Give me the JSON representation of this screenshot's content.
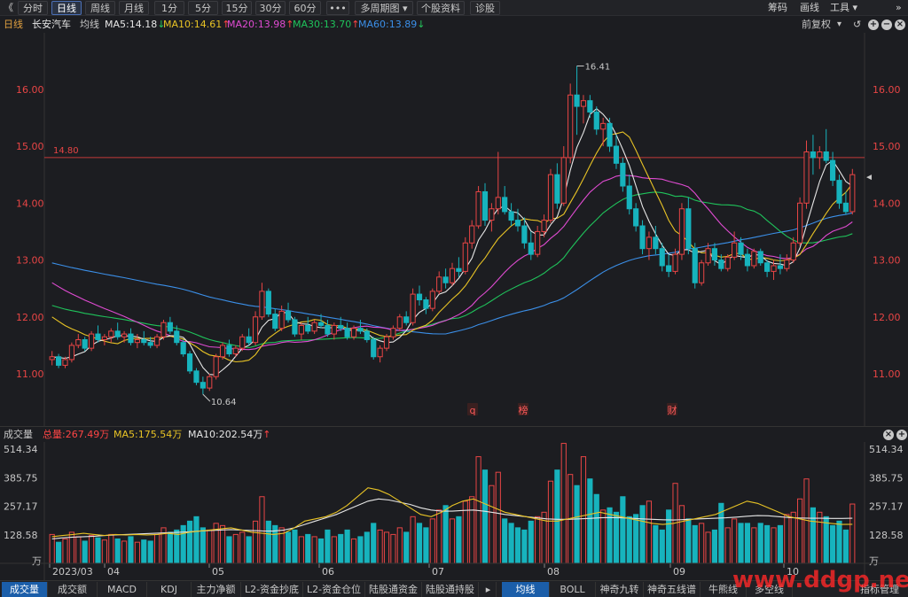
{
  "toolbar": {
    "back": "《",
    "periods": [
      "分时",
      "日线",
      "周线",
      "月线",
      "1分",
      "5分",
      "15分",
      "30分",
      "60分"
    ],
    "active_period": "日线",
    "more": "•••",
    "multi_period": "多周期图",
    "stock_info": "个股资料",
    "diagnose": "诊股",
    "right_tools": [
      "筹码",
      "画线",
      "工具"
    ]
  },
  "stock_header": {
    "period_label": "日线",
    "name": "长安汽车",
    "ma_type": "均线",
    "ma": [
      {
        "label": "MA5:14.18",
        "arrow": "↓",
        "color": "#e6e6e6",
        "arrow_color": "#24c35b"
      },
      {
        "label": "MA10:14.61",
        "arrow": "↑",
        "color": "#e8c325",
        "arrow_color": "#ff4545"
      },
      {
        "label": "MA20:13.98",
        "arrow": "↑",
        "color": "#e04bd2",
        "arrow_color": "#ff4545"
      },
      {
        "label": "MA30:13.70",
        "arrow": "↑",
        "color": "#1fc35b",
        "arrow_color": "#ff4545"
      },
      {
        "label": "MA60:13.89",
        "arrow": "↓",
        "color": "#3b8fe8",
        "arrow_color": "#24c35b"
      }
    ],
    "adjust": "前复权"
  },
  "price_axis": {
    "ticks": [
      "16.00",
      "15.00",
      "14.00",
      "13.00",
      "12.00",
      "11.00"
    ],
    "values": [
      16,
      15,
      14,
      13,
      12,
      11
    ],
    "range": [
      10.3,
      16.9
    ],
    "color": "#e84545"
  },
  "annotations": {
    "line_label": "14.80",
    "line_value": 14.8,
    "high_label": "16.41",
    "high_value": 16.41,
    "low_label": "10.64",
    "low_value": 10.64,
    "events": [
      "q",
      "榜",
      "财"
    ]
  },
  "volume_header": {
    "title": "成交量",
    "total": "总量:267.49万",
    "ma5": "MA5:175.54万",
    "ma10": "MA10:202.54万",
    "ma10_arrow": "↑"
  },
  "volume_axis": {
    "ticks": [
      "514.34",
      "385.75",
      "257.17",
      "128.58"
    ],
    "values": [
      514.34,
      385.75,
      257.17,
      128.58
    ],
    "unit": "万",
    "range": [
      0,
      514.34
    ]
  },
  "date_axis": [
    "2023/03",
    "04",
    "05",
    "06",
    "07",
    "08",
    "09",
    "10"
  ],
  "bottom_tabs_left": [
    "成交量",
    "成交额",
    "MACD",
    "KDJ",
    "主力净额",
    "L2-资金抄底",
    "L2-资金仓位",
    "陆股通资金",
    "陆股通持股"
  ],
  "bottom_tabs_right": [
    "均线",
    "BOLL",
    "神奇九转",
    "神奇五线谱",
    "牛熊线",
    "多空线"
  ],
  "bottom_manage": "指标管理",
  "watermark": "www.ddgp.net",
  "chart_data": {
    "type": "candlestick",
    "title": "长安汽车 日线",
    "candles": [
      {
        "o": 11.25,
        "h": 11.4,
        "l": 11.15,
        "c": 11.3
      },
      {
        "o": 11.3,
        "h": 11.35,
        "l": 11.1,
        "c": 11.15
      },
      {
        "o": 11.15,
        "h": 11.3,
        "l": 11.1,
        "c": 11.25
      },
      {
        "o": 11.25,
        "h": 11.55,
        "l": 11.2,
        "c": 11.5
      },
      {
        "o": 11.5,
        "h": 11.7,
        "l": 11.45,
        "c": 11.6
      },
      {
        "o": 11.6,
        "h": 11.65,
        "l": 11.4,
        "c": 11.45
      },
      {
        "o": 11.45,
        "h": 11.75,
        "l": 11.4,
        "c": 11.7
      },
      {
        "o": 11.7,
        "h": 11.85,
        "l": 11.55,
        "c": 11.6
      },
      {
        "o": 11.6,
        "h": 11.7,
        "l": 11.5,
        "c": 11.65
      },
      {
        "o": 11.65,
        "h": 11.8,
        "l": 11.55,
        "c": 11.75
      },
      {
        "o": 11.75,
        "h": 11.9,
        "l": 11.6,
        "c": 11.65
      },
      {
        "o": 11.65,
        "h": 11.75,
        "l": 11.55,
        "c": 11.7
      },
      {
        "o": 11.7,
        "h": 11.8,
        "l": 11.5,
        "c": 11.55
      },
      {
        "o": 11.55,
        "h": 11.7,
        "l": 11.45,
        "c": 11.6
      },
      {
        "o": 11.6,
        "h": 11.75,
        "l": 11.5,
        "c": 11.55
      },
      {
        "o": 11.55,
        "h": 11.65,
        "l": 11.45,
        "c": 11.5
      },
      {
        "o": 11.5,
        "h": 11.7,
        "l": 11.45,
        "c": 11.65
      },
      {
        "o": 11.65,
        "h": 11.95,
        "l": 11.6,
        "c": 11.9
      },
      {
        "o": 11.9,
        "h": 12.0,
        "l": 11.7,
        "c": 11.75
      },
      {
        "o": 11.75,
        "h": 11.85,
        "l": 11.5,
        "c": 11.55
      },
      {
        "o": 11.55,
        "h": 11.6,
        "l": 11.3,
        "c": 11.35
      },
      {
        "o": 11.35,
        "h": 11.4,
        "l": 11.0,
        "c": 11.05
      },
      {
        "o": 11.05,
        "h": 11.1,
        "l": 10.8,
        "c": 10.85
      },
      {
        "o": 10.85,
        "h": 10.95,
        "l": 10.64,
        "c": 10.75
      },
      {
        "o": 10.75,
        "h": 11.0,
        "l": 10.7,
        "c": 10.95
      },
      {
        "o": 10.95,
        "h": 11.35,
        "l": 10.9,
        "c": 11.3
      },
      {
        "o": 11.3,
        "h": 11.55,
        "l": 11.25,
        "c": 11.5
      },
      {
        "o": 11.5,
        "h": 11.6,
        "l": 11.3,
        "c": 11.35
      },
      {
        "o": 11.35,
        "h": 11.5,
        "l": 11.3,
        "c": 11.45
      },
      {
        "o": 11.45,
        "h": 11.7,
        "l": 11.4,
        "c": 11.65
      },
      {
        "o": 11.65,
        "h": 11.8,
        "l": 11.5,
        "c": 11.55
      },
      {
        "o": 11.55,
        "h": 12.1,
        "l": 11.5,
        "c": 12.0
      },
      {
        "o": 12.0,
        "h": 12.6,
        "l": 11.95,
        "c": 12.45
      },
      {
        "o": 12.45,
        "h": 12.5,
        "l": 12.0,
        "c": 12.05
      },
      {
        "o": 12.05,
        "h": 12.15,
        "l": 11.75,
        "c": 11.8
      },
      {
        "o": 11.8,
        "h": 12.2,
        "l": 11.75,
        "c": 12.1
      },
      {
        "o": 12.1,
        "h": 12.25,
        "l": 11.9,
        "c": 11.95
      },
      {
        "o": 11.95,
        "h": 12.0,
        "l": 11.65,
        "c": 11.7
      },
      {
        "o": 11.7,
        "h": 11.9,
        "l": 11.6,
        "c": 11.85
      },
      {
        "o": 11.85,
        "h": 12.0,
        "l": 11.7,
        "c": 11.75
      },
      {
        "o": 11.75,
        "h": 11.95,
        "l": 11.7,
        "c": 11.9
      },
      {
        "o": 11.9,
        "h": 12.05,
        "l": 11.8,
        "c": 11.85
      },
      {
        "o": 11.85,
        "h": 11.95,
        "l": 11.65,
        "c": 11.7
      },
      {
        "o": 11.7,
        "h": 11.9,
        "l": 11.6,
        "c": 11.85
      },
      {
        "o": 11.85,
        "h": 12.0,
        "l": 11.75,
        "c": 11.8
      },
      {
        "o": 11.8,
        "h": 11.9,
        "l": 11.6,
        "c": 11.65
      },
      {
        "o": 11.65,
        "h": 11.85,
        "l": 11.6,
        "c": 11.8
      },
      {
        "o": 11.8,
        "h": 11.95,
        "l": 11.7,
        "c": 11.75
      },
      {
        "o": 11.75,
        "h": 11.8,
        "l": 11.55,
        "c": 11.6
      },
      {
        "o": 11.6,
        "h": 11.65,
        "l": 11.25,
        "c": 11.3
      },
      {
        "o": 11.3,
        "h": 11.5,
        "l": 11.2,
        "c": 11.45
      },
      {
        "o": 11.45,
        "h": 11.7,
        "l": 11.4,
        "c": 11.65
      },
      {
        "o": 11.65,
        "h": 11.85,
        "l": 11.6,
        "c": 11.8
      },
      {
        "o": 11.8,
        "h": 12.05,
        "l": 11.75,
        "c": 12.0
      },
      {
        "o": 12.0,
        "h": 12.1,
        "l": 11.85,
        "c": 11.9
      },
      {
        "o": 11.9,
        "h": 12.5,
        "l": 11.85,
        "c": 12.4
      },
      {
        "o": 12.4,
        "h": 12.55,
        "l": 12.2,
        "c": 12.3
      },
      {
        "o": 12.3,
        "h": 12.35,
        "l": 12.05,
        "c": 12.15
      },
      {
        "o": 12.15,
        "h": 12.5,
        "l": 12.1,
        "c": 12.45
      },
      {
        "o": 12.45,
        "h": 12.8,
        "l": 12.4,
        "c": 12.7
      },
      {
        "o": 12.7,
        "h": 12.85,
        "l": 12.5,
        "c": 12.6
      },
      {
        "o": 12.6,
        "h": 12.95,
        "l": 12.55,
        "c": 12.85
      },
      {
        "o": 12.85,
        "h": 13.05,
        "l": 12.7,
        "c": 12.8
      },
      {
        "o": 12.8,
        "h": 13.4,
        "l": 12.75,
        "c": 13.3
      },
      {
        "o": 13.3,
        "h": 13.7,
        "l": 13.2,
        "c": 13.6
      },
      {
        "o": 13.6,
        "h": 14.3,
        "l": 13.55,
        "c": 14.2
      },
      {
        "o": 14.2,
        "h": 14.35,
        "l": 13.6,
        "c": 13.7
      },
      {
        "o": 13.7,
        "h": 14.0,
        "l": 13.5,
        "c": 13.9
      },
      {
        "o": 13.9,
        "h": 14.9,
        "l": 13.8,
        "c": 14.1
      },
      {
        "o": 14.1,
        "h": 14.3,
        "l": 13.8,
        "c": 13.85
      },
      {
        "o": 13.85,
        "h": 14.0,
        "l": 13.6,
        "c": 13.7
      },
      {
        "o": 13.7,
        "h": 13.9,
        "l": 13.5,
        "c": 13.6
      },
      {
        "o": 13.6,
        "h": 13.75,
        "l": 13.2,
        "c": 13.3
      },
      {
        "o": 13.3,
        "h": 13.5,
        "l": 13.0,
        "c": 13.1
      },
      {
        "o": 13.1,
        "h": 13.6,
        "l": 13.05,
        "c": 13.5
      },
      {
        "o": 13.5,
        "h": 13.8,
        "l": 13.4,
        "c": 13.7
      },
      {
        "o": 13.7,
        "h": 14.6,
        "l": 13.65,
        "c": 14.5
      },
      {
        "o": 14.5,
        "h": 14.7,
        "l": 13.9,
        "c": 14.0
      },
      {
        "o": 14.0,
        "h": 15.0,
        "l": 13.95,
        "c": 14.8
      },
      {
        "o": 14.8,
        "h": 16.1,
        "l": 14.7,
        "c": 15.9
      },
      {
        "o": 15.9,
        "h": 16.41,
        "l": 15.2,
        "c": 15.7
      },
      {
        "o": 15.7,
        "h": 15.9,
        "l": 15.4,
        "c": 15.8
      },
      {
        "o": 15.8,
        "h": 15.9,
        "l": 15.5,
        "c": 15.6
      },
      {
        "o": 15.6,
        "h": 15.7,
        "l": 15.2,
        "c": 15.3
      },
      {
        "o": 15.3,
        "h": 15.5,
        "l": 15.0,
        "c": 15.4
      },
      {
        "o": 15.4,
        "h": 15.5,
        "l": 14.9,
        "c": 15.0
      },
      {
        "o": 15.0,
        "h": 15.2,
        "l": 14.6,
        "c": 14.7
      },
      {
        "o": 14.7,
        "h": 14.8,
        "l": 14.2,
        "c": 14.3
      },
      {
        "o": 14.3,
        "h": 14.5,
        "l": 13.8,
        "c": 13.9
      },
      {
        "o": 13.9,
        "h": 14.0,
        "l": 13.5,
        "c": 13.6
      },
      {
        "o": 13.6,
        "h": 13.7,
        "l": 13.1,
        "c": 13.2
      },
      {
        "o": 13.2,
        "h": 13.5,
        "l": 13.0,
        "c": 13.4
      },
      {
        "o": 13.4,
        "h": 13.6,
        "l": 13.1,
        "c": 13.2
      },
      {
        "o": 13.2,
        "h": 13.3,
        "l": 12.8,
        "c": 12.9
      },
      {
        "o": 12.9,
        "h": 13.1,
        "l": 12.7,
        "c": 12.8
      },
      {
        "o": 12.8,
        "h": 13.2,
        "l": 12.75,
        "c": 13.1
      },
      {
        "o": 13.1,
        "h": 14.0,
        "l": 13.0,
        "c": 13.9
      },
      {
        "o": 13.9,
        "h": 14.1,
        "l": 13.1,
        "c": 13.2
      },
      {
        "o": 13.2,
        "h": 13.3,
        "l": 12.5,
        "c": 12.6
      },
      {
        "o": 12.6,
        "h": 13.0,
        "l": 12.55,
        "c": 12.95
      },
      {
        "o": 12.95,
        "h": 13.3,
        "l": 12.9,
        "c": 13.2
      },
      {
        "o": 13.2,
        "h": 13.3,
        "l": 12.9,
        "c": 13.0
      },
      {
        "o": 13.0,
        "h": 13.1,
        "l": 12.8,
        "c": 12.85
      },
      {
        "o": 12.85,
        "h": 13.1,
        "l": 12.8,
        "c": 13.05
      },
      {
        "o": 13.05,
        "h": 13.5,
        "l": 13.0,
        "c": 13.3
      },
      {
        "o": 13.3,
        "h": 13.4,
        "l": 13.0,
        "c": 13.1
      },
      {
        "o": 13.1,
        "h": 13.2,
        "l": 12.8,
        "c": 12.9
      },
      {
        "o": 12.9,
        "h": 13.2,
        "l": 12.85,
        "c": 13.15
      },
      {
        "o": 13.15,
        "h": 13.2,
        "l": 12.9,
        "c": 12.95
      },
      {
        "o": 12.95,
        "h": 13.0,
        "l": 12.7,
        "c": 12.8
      },
      {
        "o": 12.8,
        "h": 13.0,
        "l": 12.65,
        "c": 12.9
      },
      {
        "o": 12.9,
        "h": 13.1,
        "l": 12.75,
        "c": 12.85
      },
      {
        "o": 12.85,
        "h": 13.1,
        "l": 12.8,
        "c": 13.0
      },
      {
        "o": 13.0,
        "h": 13.4,
        "l": 12.95,
        "c": 13.3
      },
      {
        "o": 13.3,
        "h": 14.1,
        "l": 13.25,
        "c": 14.0
      },
      {
        "o": 14.0,
        "h": 15.1,
        "l": 13.9,
        "c": 14.9
      },
      {
        "o": 14.9,
        "h": 15.2,
        "l": 14.5,
        "c": 14.8
      },
      {
        "o": 14.8,
        "h": 15.0,
        "l": 14.6,
        "c": 14.9
      },
      {
        "o": 14.9,
        "h": 15.3,
        "l": 14.7,
        "c": 14.75
      },
      {
        "o": 14.75,
        "h": 14.9,
        "l": 14.3,
        "c": 14.4
      },
      {
        "o": 14.4,
        "h": 14.5,
        "l": 13.9,
        "c": 14.0
      },
      {
        "o": 14.0,
        "h": 14.2,
        "l": 13.8,
        "c": 13.85
      },
      {
        "o": 13.85,
        "h": 14.6,
        "l": 13.8,
        "c": 14.5
      }
    ],
    "volume": [
      130,
      95,
      110,
      140,
      120,
      100,
      125,
      115,
      105,
      130,
      110,
      100,
      120,
      95,
      105,
      100,
      130,
      160,
      140,
      150,
      170,
      190,
      210,
      160,
      150,
      180,
      170,
      120,
      130,
      140,
      120,
      190,
      300,
      190,
      170,
      160,
      140,
      150,
      120,
      130,
      120,
      110,
      150,
      120,
      130,
      150,
      110,
      120,
      140,
      180,
      150,
      140,
      130,
      160,
      140,
      210,
      180,
      160,
      200,
      240,
      260,
      200,
      210,
      280,
      300,
      480,
      420,
      350,
      410,
      200,
      180,
      160,
      150,
      190,
      210,
      230,
      370,
      420,
      540,
      400,
      350,
      480,
      380,
      310,
      240,
      250,
      230,
      300,
      210,
      220,
      260,
      280,
      170,
      150,
      240,
      360,
      260,
      200,
      170,
      180,
      140,
      150,
      270,
      160,
      200,
      180,
      180,
      160,
      180,
      170,
      160,
      170,
      220,
      230,
      290,
      380,
      250,
      230,
      210,
      170,
      190,
      150,
      267
    ],
    "volume_ma5": [
      120,
      125,
      130,
      135,
      130,
      125,
      130,
      128,
      130,
      128,
      130,
      135,
      130,
      140,
      145,
      150,
      155,
      160,
      150,
      140,
      135,
      130,
      135,
      160,
      190,
      200,
      210,
      230,
      260,
      300,
      340,
      330,
      310,
      280,
      250,
      220,
      210,
      230,
      260,
      280,
      290,
      270,
      250,
      230,
      220,
      210,
      200,
      190,
      190,
      200,
      210,
      220,
      230,
      220,
      210,
      200,
      190,
      180,
      175,
      180,
      190,
      200,
      210,
      220,
      240,
      260,
      280,
      270,
      250,
      230,
      210,
      200,
      190,
      185,
      180,
      175,
      176
    ],
    "volume_ma10": [
      110,
      115,
      118,
      120,
      122,
      125,
      128,
      130,
      132,
      134,
      136,
      138,
      140,
      142,
      145,
      148,
      150,
      152,
      150,
      148,
      146,
      145,
      150,
      160,
      175,
      190,
      205,
      220,
      240,
      260,
      280,
      290,
      285,
      275,
      265,
      250,
      240,
      235,
      235,
      238,
      240,
      235,
      228,
      220,
      215,
      210,
      205,
      200,
      198,
      198,
      200,
      202,
      205,
      206,
      205,
      203,
      200,
      198,
      196,
      195,
      197,
      199,
      201,
      203,
      205,
      208,
      212,
      215,
      214,
      210,
      206,
      204,
      203,
      203,
      202,
      202,
      203
    ]
  }
}
